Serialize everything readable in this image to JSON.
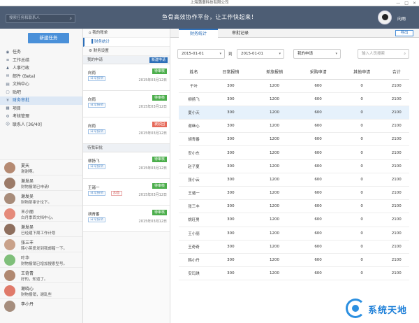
{
  "window": {
    "title": "上海蒲谱科技有限公司",
    "controls": [
      "—",
      "□",
      "×"
    ]
  },
  "header": {
    "search_placeholder": "搜索任务和联系人",
    "slogan": "鱼骨高效协作平台，让工作快起来！",
    "user_name": "向雨"
  },
  "sidebar": {
    "new_task_label": "新建任务",
    "menu": [
      {
        "icon": "target-icon",
        "glyph": "◉",
        "label": "任务"
      },
      {
        "icon": "document-icon",
        "glyph": "≡",
        "label": "工作总结"
      },
      {
        "icon": "person-icon",
        "glyph": "♟",
        "label": "人事行政"
      },
      {
        "icon": "mail-icon",
        "glyph": "✉",
        "label": "邮件 (Beta)"
      },
      {
        "icon": "folder-icon",
        "glyph": "▤",
        "label": "文档中心"
      },
      {
        "icon": "chat-icon",
        "glyph": "▢",
        "label": "贴吧"
      },
      {
        "icon": "money-icon",
        "glyph": "¥",
        "label": "财务审批"
      },
      {
        "icon": "project-icon",
        "glyph": "▦",
        "label": "项目"
      },
      {
        "icon": "gear-icon",
        "glyph": "⚙",
        "label": "考核管理"
      },
      {
        "icon": "contacts-icon",
        "glyph": "☺",
        "label": "联系人 [36/40]"
      }
    ],
    "active_menu": 6,
    "contacts": [
      {
        "name": "夏天",
        "msg": "谢谢啊。",
        "color": "#b58a72"
      },
      {
        "name": "谢发吴",
        "msg": "财物报销已申请!",
        "color": "#9c7b68"
      },
      {
        "name": "谢发吴",
        "msg": "财物部审计论下。",
        "color": "#a88c7a"
      },
      {
        "name": "王小丽",
        "msg": "白月季西文档中心。",
        "color": "#e58a7a"
      },
      {
        "name": "谢发吴",
        "msg": "已经建下周工作计划",
        "color": "#8e6f5e"
      },
      {
        "name": "张三丰",
        "msg": "韩小英爱发到我邮箱一下。",
        "color": "#c9a28a"
      },
      {
        "name": "叶华",
        "msg": "财物报销已增加搜索型号。",
        "color": "#7fbf7a"
      },
      {
        "name": "王奇青",
        "msg": "好的，知道了。",
        "color": "#b08870"
      },
      {
        "name": "谢晓心",
        "msg": "财物报销，谢乱些",
        "color": "#e07a6a"
      },
      {
        "name": "李小丹",
        "msg": "",
        "color": "#a58d7d"
      }
    ]
  },
  "mid": {
    "nav": [
      {
        "icon": "home-icon",
        "glyph": "⌂",
        "label": "我的账单"
      },
      {
        "icon": "chart-icon",
        "glyph": "▐",
        "label": "财务统计"
      },
      {
        "icon": "settings-icon",
        "glyph": "⚙",
        "label": "财务设置"
      }
    ],
    "active_nav": 1,
    "my_apply": {
      "title": "我的申请",
      "new_button": "新建申请",
      "items": [
        {
          "name": "向雨",
          "tag": "日常报销",
          "badge": "待审核",
          "badge_color": "#4cae4c",
          "date": "2015年03月12日"
        },
        {
          "name": "向雨",
          "tag": "日常报销",
          "badge": "待审核",
          "badge_color": "#4cae4c",
          "date": "2015年03月12日"
        },
        {
          "name": "向雨",
          "tag": "日常报销",
          "badge": "被驳回",
          "badge_color": "#e66a5a",
          "date": "2015年03月12日"
        }
      ]
    },
    "pending": {
      "title": "待我审批",
      "items": [
        {
          "name": "柳扬飞",
          "tag": "日常报销",
          "tag2": "",
          "badge": "待审核",
          "badge_color": "#4cae4c",
          "date": "2015年03月12日"
        },
        {
          "name": "王诸一",
          "tag": "日常报销",
          "tag2": "加急",
          "badge": "待审核",
          "badge_color": "#4cae4c",
          "date": "2015年03月12日"
        },
        {
          "name": "胡青番",
          "tag": "日常报销",
          "tag2": "",
          "badge": "待审核",
          "badge_color": "#4cae4c",
          "date": "2015年03月12日"
        }
      ]
    }
  },
  "main": {
    "tabs": [
      {
        "label": "财务统计"
      },
      {
        "label": "审批记录"
      }
    ],
    "export_label": "导出",
    "filters": {
      "date_from": "2015-01-01",
      "to_label": "到",
      "date_to": "2015-01-01",
      "scope": "我的申请",
      "search_placeholder": "输入人员搜索"
    },
    "table": {
      "headers": [
        "姓名",
        "日常报销",
        "差旅报销",
        "采购申请",
        "其他申请",
        "合计"
      ],
      "rows": [
        [
          "千叶",
          "300",
          "1200",
          "600",
          "0",
          "2100"
        ],
        [
          "柳扬飞",
          "300",
          "1200",
          "600",
          "0",
          "2100"
        ],
        [
          "夏小天",
          "300",
          "1200",
          "600",
          "0",
          "2100"
        ],
        [
          "谢继心",
          "300",
          "1200",
          "600",
          "0",
          "2100"
        ],
        [
          "胡青番",
          "300",
          "1200",
          "600",
          "0",
          "2100"
        ],
        [
          "安小东",
          "300",
          "1200",
          "600",
          "0",
          "2100"
        ],
        [
          "赵子夏",
          "300",
          "1200",
          "600",
          "0",
          "2100"
        ],
        [
          "张小云",
          "300",
          "1200",
          "600",
          "0",
          "2100"
        ],
        [
          "王诸一",
          "300",
          "1200",
          "600",
          "0",
          "2100"
        ],
        [
          "张三丰",
          "300",
          "1200",
          "600",
          "0",
          "2100"
        ],
        [
          "姚旺男",
          "300",
          "1200",
          "600",
          "0",
          "2100"
        ],
        [
          "王小丽",
          "300",
          "1200",
          "600",
          "0",
          "2100"
        ],
        [
          "王奇奇",
          "300",
          "1200",
          "600",
          "0",
          "2100"
        ],
        [
          "韩小丹",
          "300",
          "1200",
          "600",
          "0",
          "2100"
        ],
        [
          "安玛琪",
          "300",
          "1200",
          "600",
          "0",
          "2100"
        ]
      ],
      "highlight_row": 2
    }
  },
  "watermark": {
    "text": "系统天地"
  }
}
